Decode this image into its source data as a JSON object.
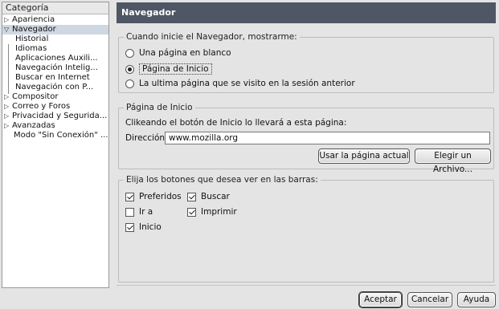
{
  "sidebar": {
    "header": "Categoría",
    "items": [
      {
        "label": "Apariencia",
        "twisty": "▷"
      },
      {
        "label": "Navegador",
        "twisty": "▽"
      },
      {
        "label": "Historial"
      },
      {
        "label": "Idiomas"
      },
      {
        "label": "Aplicaciones Auxili..."
      },
      {
        "label": "Navegación Intelig..."
      },
      {
        "label": "Buscar en Internet"
      },
      {
        "label": "Navegación con P..."
      },
      {
        "label": "Compositor",
        "twisty": "▷"
      },
      {
        "label": "Correo y Foros",
        "twisty": "▷"
      },
      {
        "label": "Privacidad y Segurida...",
        "twisty": "▷"
      },
      {
        "label": "Avanzadas",
        "twisty": "▷"
      },
      {
        "label": "Modo \"Sin Conexión\" ..."
      }
    ]
  },
  "panel": {
    "title": "Navegador",
    "startup": {
      "title": "Cuando inicie el Navegador, mostrarme:",
      "options": [
        {
          "label": "Una página en blanco",
          "selected": false
        },
        {
          "label": "Página de Inicio",
          "selected": true
        },
        {
          "label": "La ultima página que se visito en la sesión anterior",
          "selected": false
        }
      ]
    },
    "homepage": {
      "title": "Página de Inicio",
      "description": "Clikeando el botón de Inicio lo llevará a esta página:",
      "address_label": "Dirección:",
      "address_value": "www.mozilla.org",
      "use_current_label": "Usar la página actual",
      "choose_file_label": "Elegir un Archivo..."
    },
    "toolbar_buttons": {
      "title": "Elija los botones que desea ver en las barras:",
      "options": [
        {
          "label": "Preferidos",
          "checked": true
        },
        {
          "label": "Buscar",
          "checked": true
        },
        {
          "label": "Ir a",
          "checked": false
        },
        {
          "label": "Imprimir",
          "checked": true
        },
        {
          "label": "Inicio",
          "checked": true
        }
      ]
    }
  },
  "footer": {
    "ok_label": "Aceptar",
    "cancel_label": "Cancelar",
    "help_label": "Ayuda"
  }
}
